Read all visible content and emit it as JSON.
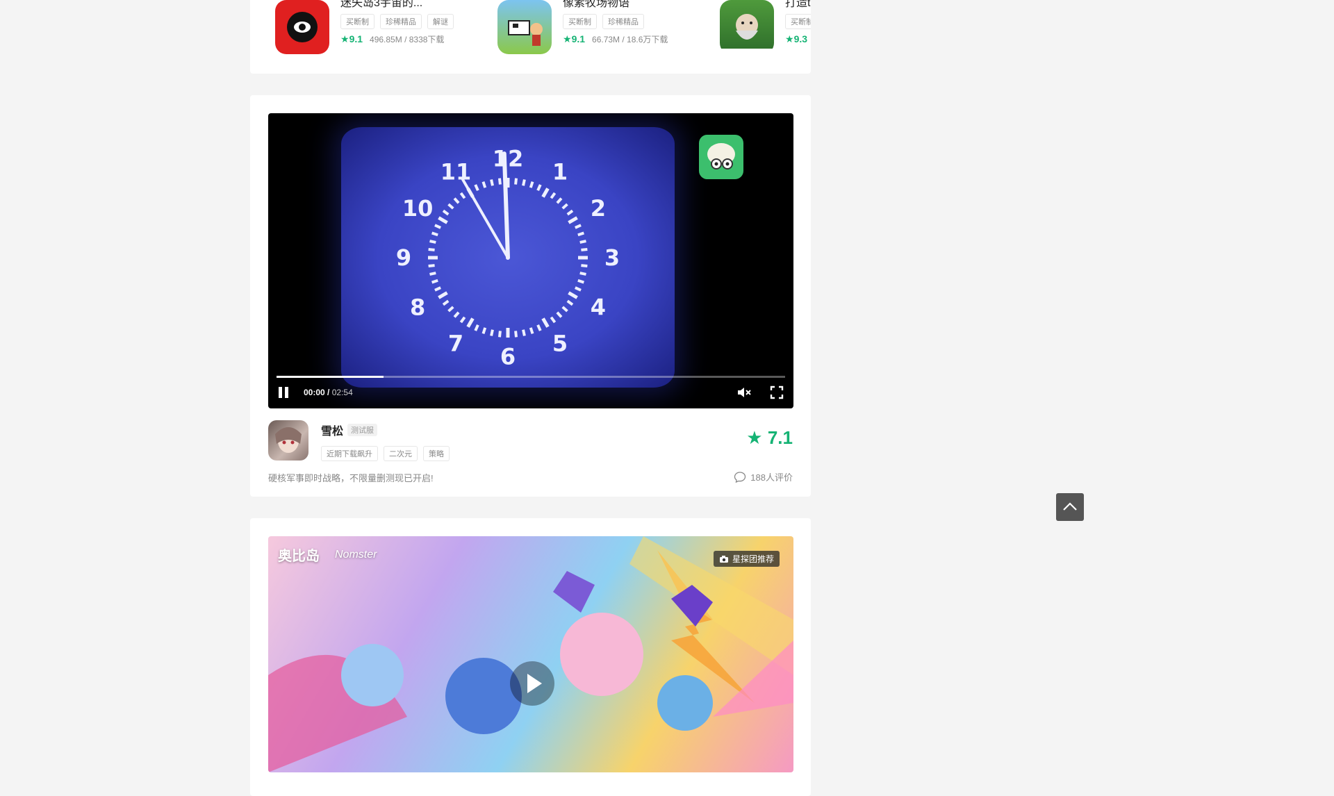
{
  "top_apps": [
    {
      "name": "迷失岛3宇宙的...",
      "tags": [
        "买断制",
        "珍稀精品",
        "解谜"
      ],
      "rating": "9.1",
      "meta": "496.85M / 8338下载",
      "icon_color": "#e02020"
    },
    {
      "name": "像素牧场物语",
      "tags": [
        "买断制",
        "珍稀精品"
      ],
      "rating": "9.1",
      "meta": "66.73M / 18.6万下载",
      "icon_color": "#5ba8e0"
    },
    {
      "name": "打造t",
      "tags": [
        "买断制"
      ],
      "rating": "9.3",
      "meta": "",
      "icon_color": "#3c8a3c"
    }
  ],
  "video": {
    "current_time": "00:00",
    "duration": "02:54",
    "progress_fraction": 0.21,
    "muted": true
  },
  "game": {
    "name": "雪松",
    "badge": "测试服",
    "tags": [
      "近期下载飙升",
      "二次元",
      "策略"
    ],
    "rating": "7.1",
    "description": "硬核军事即时战略，不限量删测现已开启!",
    "reviews": "188人评价"
  },
  "banner": {
    "logo": "奥比岛",
    "logo2": "Nomster",
    "recommend_badge": "星探团推荐"
  },
  "clock_numbers": [
    "12",
    "1",
    "2",
    "3",
    "4",
    "5",
    "6",
    "7",
    "8",
    "9",
    "10",
    "11"
  ],
  "colors": {
    "accent": "#15b374"
  }
}
